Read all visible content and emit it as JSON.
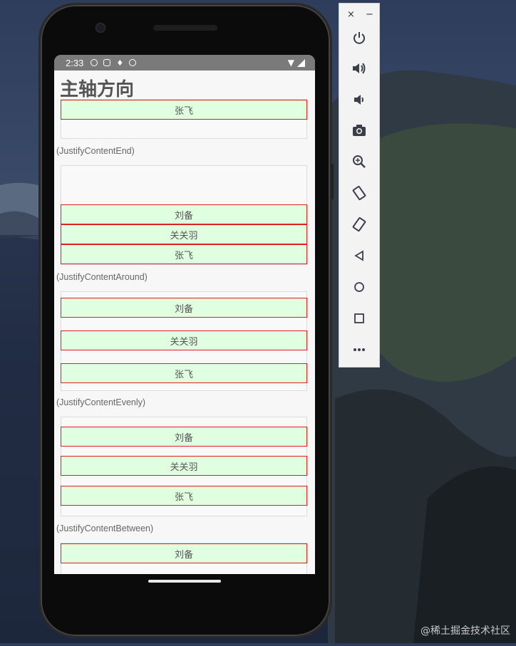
{
  "status_bar": {
    "time": "2:33"
  },
  "page": {
    "title": "主轴方向",
    "sections": [
      {
        "label": "(JustifyContentEnd)"
      },
      {
        "label": "(JustifyContentAround)"
      },
      {
        "label": "(JustifyContentEvenly)"
      },
      {
        "label": "(JustifyContentBetween)"
      }
    ],
    "items": {
      "liubei": "刘备",
      "guanyu": "关关羽",
      "zhangfei": "张飞"
    }
  },
  "emulator_panel": {
    "close": "×",
    "minimize": "−",
    "buttons": [
      "power-icon",
      "volume-up-icon",
      "volume-down-icon",
      "camera-icon",
      "zoom-icon",
      "rotate-left-icon",
      "rotate-right-icon",
      "back-icon",
      "home-icon",
      "overview-icon",
      "more-icon"
    ]
  },
  "watermark": "@稀土掘金技术社区",
  "colors": {
    "item_bg": "#e0ffe0",
    "item_border": "#e02020",
    "status_bar": "#7a7a7a"
  }
}
